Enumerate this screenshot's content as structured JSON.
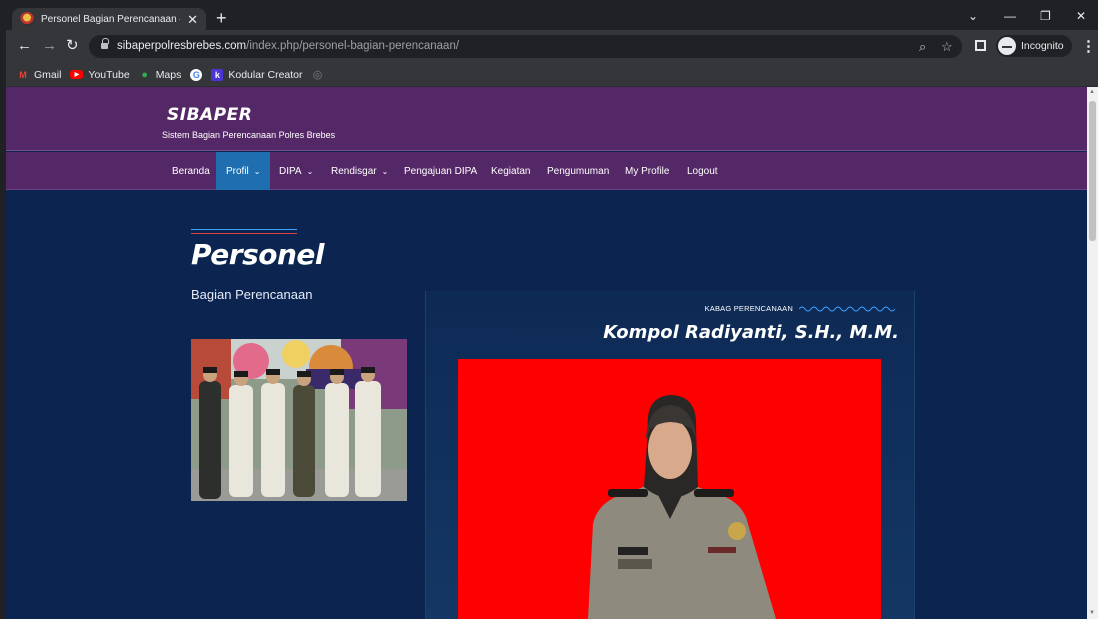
{
  "browser": {
    "tab_title": "Personel Bagian Perencanaan – S",
    "url_host": "sibaperpolresbrebes.com",
    "url_path": "/index.php/personel-bagian-perencanaan/",
    "incognito_label": "Incognito",
    "bookmarks": [
      {
        "label": "Gmail",
        "icon": "gmail-icon"
      },
      {
        "label": "YouTube",
        "icon": "youtube-icon"
      },
      {
        "label": "Maps",
        "icon": "maps-icon"
      },
      {
        "label": "",
        "icon": "google-icon"
      },
      {
        "label": "Kodular Creator",
        "icon": "kodular-icon"
      }
    ]
  },
  "site": {
    "logo": "SIBAPER",
    "tagline": "Sistem Bagian Perencanaan Polres Brebes",
    "nav": [
      {
        "label": "Beranda"
      },
      {
        "label": "Profil",
        "active": true,
        "has_dropdown": true
      },
      {
        "label": "DIPA",
        "has_dropdown": true
      },
      {
        "label": "Rendisgar",
        "has_dropdown": true
      },
      {
        "label": "Pengajuan DIPA"
      },
      {
        "label": "Kegiatan"
      },
      {
        "label": "Pengumuman"
      },
      {
        "label": "My Profile"
      },
      {
        "label": "Logout"
      }
    ],
    "colors": {
      "header": "#542866",
      "nav_active": "#1f6fb0",
      "body": "#0b2550",
      "portrait_bg": "#fe0000"
    }
  },
  "page": {
    "title": "Personel",
    "subtitle": "Bagian Perencanaan",
    "card": {
      "role": "KABAG PERENCANAAN",
      "name": "Kompol Radiyanti, S.H., M.M."
    }
  }
}
